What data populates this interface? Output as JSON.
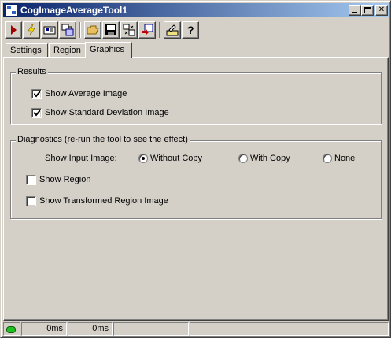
{
  "window": {
    "title": "CogImageAverageTool1"
  },
  "title_buttons": {
    "minimize": "minimize-icon",
    "maximize": "maximize-icon",
    "close": "✕"
  },
  "toolbar": {
    "buttons": [
      {
        "name": "run-icon"
      },
      {
        "name": "electric-icon"
      },
      {
        "name": "show-image-icon"
      },
      {
        "name": "local-display-icon"
      },
      {
        "name": "open-folder-icon"
      },
      {
        "name": "save-icon"
      },
      {
        "name": "reset-icon"
      },
      {
        "name": "replace-icon"
      },
      {
        "name": "edit-icon"
      },
      {
        "name": "help-icon"
      }
    ]
  },
  "tabs": [
    {
      "label": "Settings",
      "active": false
    },
    {
      "label": "Region",
      "active": false
    },
    {
      "label": "Graphics",
      "active": true
    }
  ],
  "results": {
    "legend": "Results",
    "show_average": {
      "label": "Show Average Image",
      "checked": true
    },
    "show_stddev": {
      "label": "Show Standard Deviation Image",
      "checked": true
    }
  },
  "diagnostics": {
    "legend": "Diagnostics (re-run the tool to see the effect)",
    "input_label": "Show Input Image:",
    "options": [
      {
        "label": "Without Copy",
        "selected": true
      },
      {
        "label": "With Copy",
        "selected": false
      },
      {
        "label": "None",
        "selected": false
      }
    ],
    "show_region": {
      "label": "Show Region",
      "checked": false
    },
    "show_transformed": {
      "label": "Show Transformed Region Image",
      "checked": false
    }
  },
  "status": {
    "led_color": "#20c020",
    "time1": "0ms",
    "time2": "0ms"
  }
}
